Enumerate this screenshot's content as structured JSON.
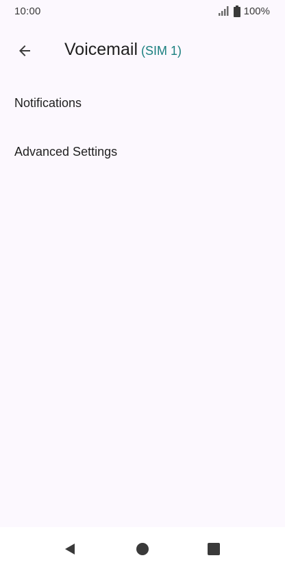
{
  "status_bar": {
    "time": "10:00",
    "battery": "100%",
    "icons": [
      "signal-icon",
      "battery-icon"
    ]
  },
  "app_bar": {
    "title": "Voicemail",
    "subtitle": "(SIM 1)",
    "back_icon": "arrow-back-icon",
    "accent_color": "#1A7F7F"
  },
  "list": {
    "items": [
      {
        "label": "Notifications"
      },
      {
        "label": "Advanced Settings"
      }
    ]
  },
  "nav_bar": {
    "buttons": [
      "back-triangle-icon",
      "home-circle-icon",
      "recents-square-icon"
    ]
  },
  "colors": {
    "background": "#FCF8FE",
    "text": "#1F1F1F",
    "icon": "#3A3A3A"
  }
}
